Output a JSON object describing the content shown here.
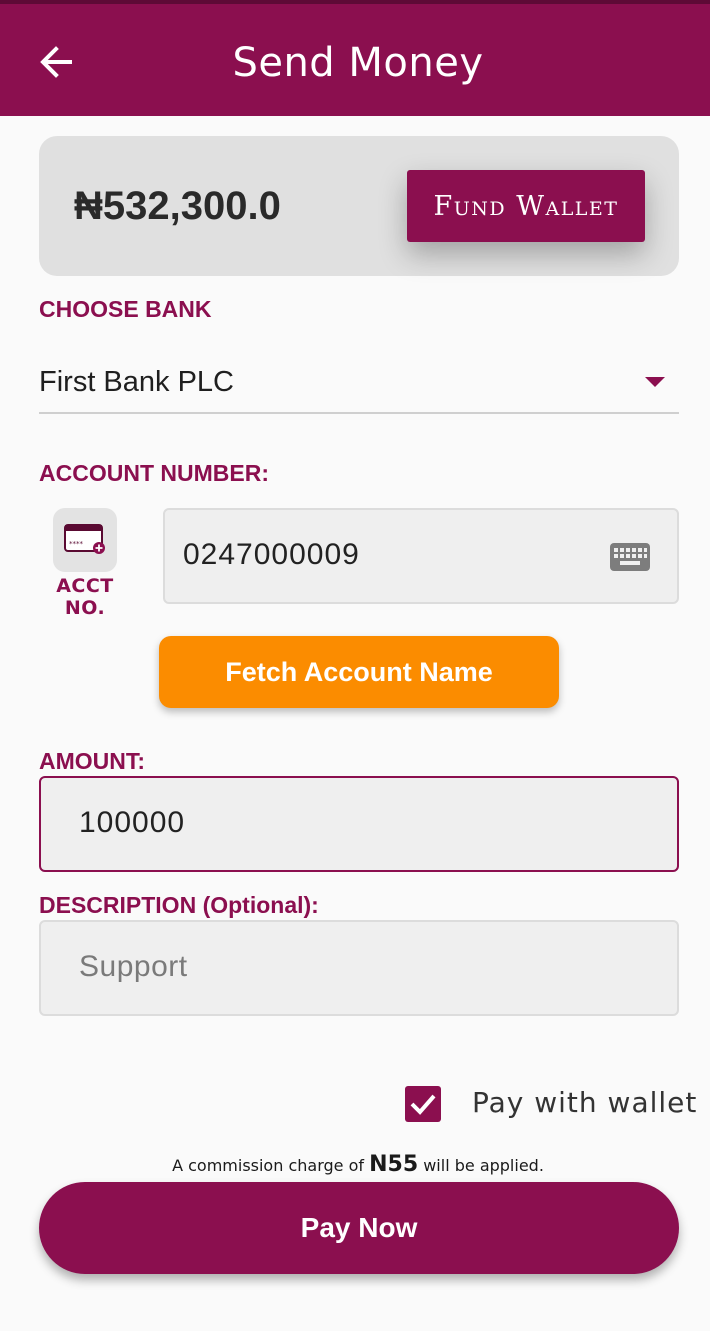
{
  "header": {
    "title": "Send Money",
    "back_icon": "arrow-left-icon"
  },
  "wallet": {
    "balance": "₦532,300.0",
    "fund_button_label": "Fund Wallet"
  },
  "bank": {
    "label": "CHOOSE BANK",
    "selected": "First Bank PLC"
  },
  "account": {
    "label": "ACCOUNT NUMBER:",
    "icon_label": "ACCT NO.",
    "value": "0247000009",
    "keyboard_icon": "keyboard-icon"
  },
  "fetch_button_label": "Fetch Account Name",
  "amount": {
    "label": "AMOUNT:",
    "value": "100000"
  },
  "description": {
    "label": "DESCRIPTION (Optional):",
    "placeholder": "Support"
  },
  "pay_with_wallet": {
    "label": "Pay with wallet",
    "checked": true
  },
  "commission": {
    "prefix": "A commission charge of",
    "amount": "N55",
    "suffix": "will be applied."
  },
  "pay_button_label": "Pay Now",
  "colors": {
    "primary": "#8b0f4f",
    "accent": "#fb8c00",
    "background": "#fafafa"
  }
}
